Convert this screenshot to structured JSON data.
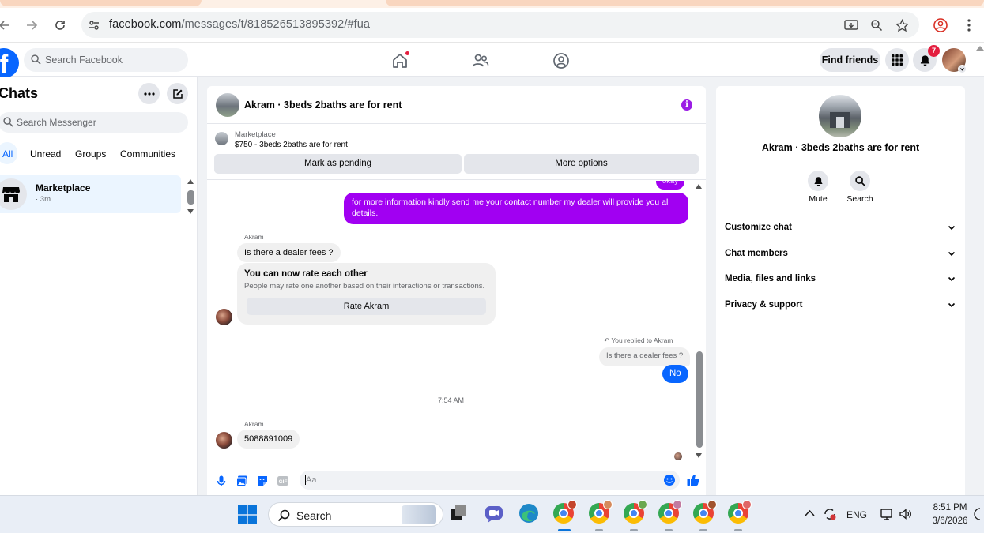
{
  "browser": {
    "url_host": "facebook.com",
    "url_path": "/messages/t/818526513895392/#fua"
  },
  "fb_nav": {
    "search_placeholder": "Search Facebook",
    "find_friends_label": "Find friends",
    "notification_count": "7"
  },
  "chats": {
    "title": "Chats",
    "search_placeholder": "Search Messenger",
    "filters": [
      "All",
      "Unread",
      "Groups",
      "Communities"
    ],
    "active_filter": "All",
    "items": [
      {
        "name": "Marketplace",
        "time": "· 3m"
      }
    ]
  },
  "conversation": {
    "title": "Akram · 3beds 2baths are for rent",
    "marketplace_label": "Marketplace",
    "listing": "$750 - 3beds 2baths are for rent",
    "mark_pending_label": "Mark as pending",
    "more_options_label": "More options",
    "messages": {
      "partial_top": "okay",
      "outgoing_1": "for more information kindly send me your contact number my dealer will provide you all  details.",
      "sender_1": "Akram",
      "incoming_1": "Is there a dealer fees ?",
      "rate_title": "You can now rate each other",
      "rate_subtitle": "People may rate one another based on their interactions or transactions.",
      "rate_button": "Rate Akram",
      "replied_label": "You replied to Akram",
      "quoted_text": "Is there a dealer fees ?",
      "outgoing_2": "No",
      "timestamp": "7:54 AM",
      "sender_2": "Akram",
      "incoming_2": "5088891009"
    },
    "composer_placeholder": "Aa"
  },
  "info_panel": {
    "name": "Akram · 3beds 2baths are for rent",
    "actions": [
      {
        "label": "Mute",
        "icon": "bell-icon"
      },
      {
        "label": "Search",
        "icon": "search-icon"
      }
    ],
    "sections": [
      "Customize chat",
      "Chat members",
      "Media, files and links",
      "Privacy & support"
    ]
  },
  "taskbar": {
    "search_label": "Search",
    "language": "ENG",
    "time": "8:51 PM",
    "date": "3/6/2026"
  },
  "colors": {
    "fb_blue": "#0866ff",
    "outgoing_purple": "#a100f2",
    "badge_red": "#e41e3f"
  }
}
